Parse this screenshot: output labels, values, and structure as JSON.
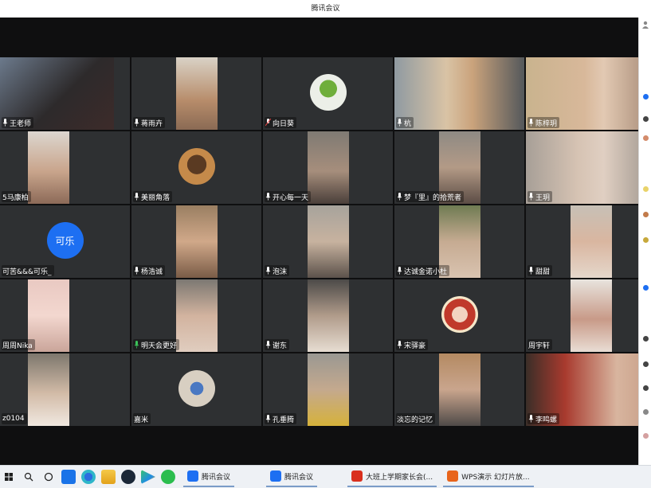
{
  "window": {
    "title": "腾讯会议"
  },
  "participants": [
    {
      "name": "王老师"
    },
    {
      "name": "蒋雨卉"
    },
    {
      "name": "向日葵"
    },
    {
      "name": "杭"
    },
    {
      "name": "陈梓玥"
    },
    {
      "name": "5马康柏"
    },
    {
      "name": "美丽角落"
    },
    {
      "name": "开心每一天"
    },
    {
      "name": "梦『里』的拾荒者"
    },
    {
      "name": "王玥"
    },
    {
      "name": "可苦&&&可乐_"
    },
    {
      "name": "杨浩诚"
    },
    {
      "name": "泡沫"
    },
    {
      "name": "达诚金诺小杜"
    },
    {
      "name": "甜甜"
    },
    {
      "name": "周周Nika"
    },
    {
      "name": "明天会更好"
    },
    {
      "name": "谢东"
    },
    {
      "name": "宋驿豪"
    },
    {
      "name": "周宇轩"
    },
    {
      "name": "z0104"
    },
    {
      "name": "嘉米"
    },
    {
      "name": "孔垂腾"
    },
    {
      "name": "淡忘的记忆"
    },
    {
      "name": "李鸣螺"
    }
  ],
  "avatars": {
    "kele_text": "可乐"
  },
  "taskbar": {
    "apps": [
      {
        "label": "腾讯会议",
        "icon": "tencent-meeting-icon",
        "color": "#1d6ff2"
      },
      {
        "label": "腾讯会议",
        "icon": "tencent-meeting-icon",
        "color": "#1d6ff2"
      },
      {
        "label": "大班上学期家长会(...",
        "icon": "wps-writer-icon",
        "color": "#d9301e"
      },
      {
        "label": "WPS演示 幻灯片放...",
        "icon": "wps-presentation-icon",
        "color": "#e8641b"
      }
    ]
  }
}
